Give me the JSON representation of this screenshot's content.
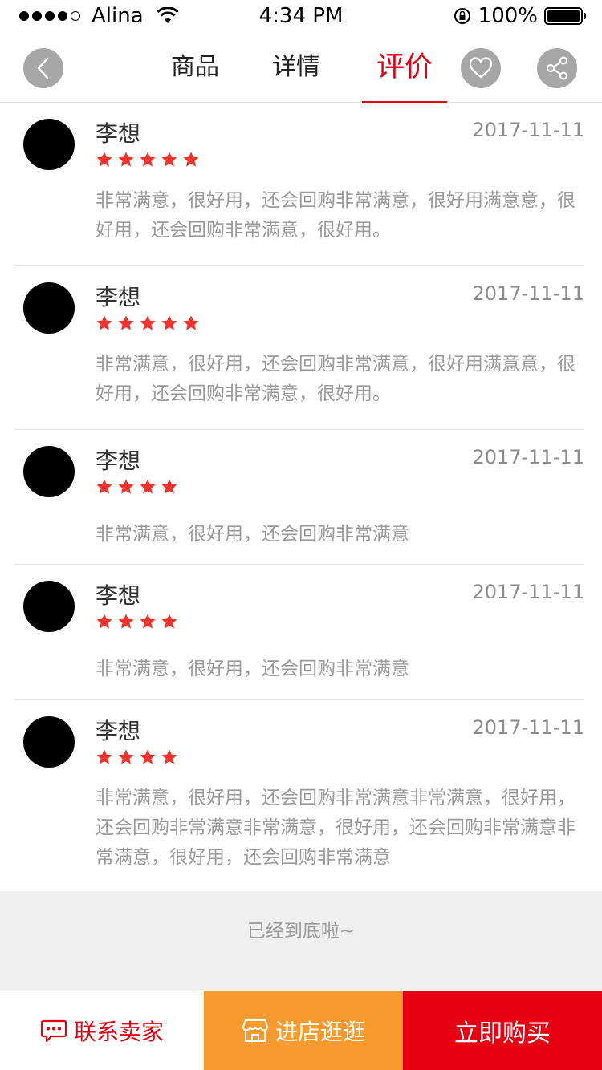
{
  "status_bar": {
    "carrier": "Alina",
    "time": "4:34 PM",
    "battery": "100%",
    "icons": [
      "signal-dots-icon",
      "wifi-icon",
      "rotation-lock-icon",
      "battery-icon"
    ]
  },
  "nav": {
    "tabs": [
      {
        "label": "商品",
        "active": false
      },
      {
        "label": "详情",
        "active": false
      },
      {
        "label": "评价",
        "active": true
      }
    ],
    "icons": [
      "back-icon",
      "heart-icon",
      "share-icon"
    ]
  },
  "reviews": [
    {
      "name": "李想",
      "date": "2017-11-11",
      "rating": 5,
      "text": "非常满意，很好用，还会回购非常满意，很好用满意意，很好用，还会回购非常满意，很好用。"
    },
    {
      "name": "李想",
      "date": "2017-11-11",
      "rating": 5,
      "text": "非常满意，很好用，还会回购非常满意，很好用满意意，很好用，还会回购非常满意，很好用。"
    },
    {
      "name": "李想",
      "date": "2017-11-11",
      "rating": 4,
      "text": "非常满意，很好用，还会回购非常满意"
    },
    {
      "name": "李想",
      "date": "2017-11-11",
      "rating": 4,
      "text": "非常满意，很好用，还会回购非常满意"
    },
    {
      "name": "李想",
      "date": "2017-11-11",
      "rating": 4,
      "text": "非常满意，很好用，还会回购非常满意非常满意，很好用，还会回购非常满意非常满意，很好用，还会回购非常满意非常满意，很好用，还会回购非常满意"
    }
  ],
  "end_text": "已经到底啦~",
  "bottom_bar": {
    "contact_label": "联系卖家",
    "shop_label": "进店逛逛",
    "buy_label": "立即购买"
  },
  "colors": {
    "accent": "#e60012",
    "shop_orange": "#f99a2e",
    "star": "#f0332d",
    "muted_text": "#9a9a9a"
  }
}
